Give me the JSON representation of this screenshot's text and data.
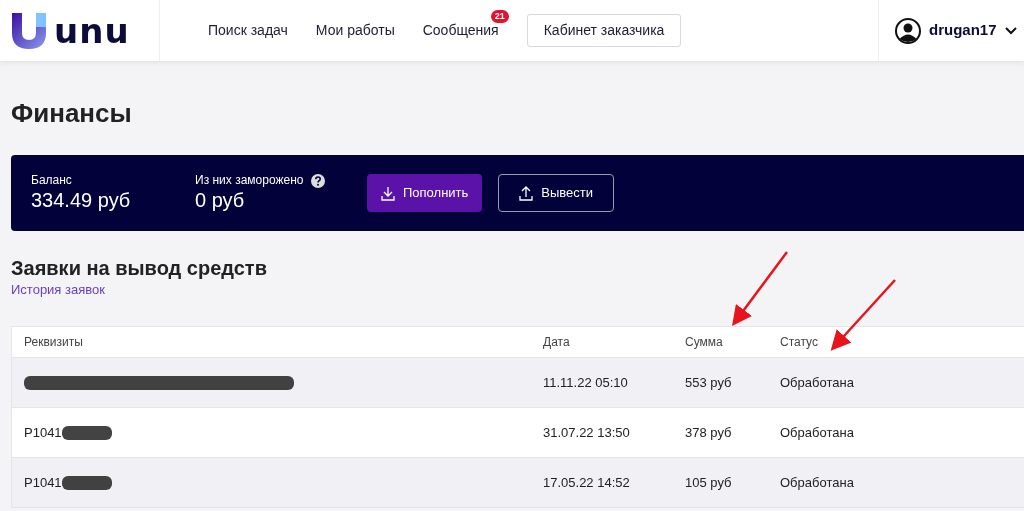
{
  "header": {
    "logo_text": "unu",
    "nav": [
      {
        "label": "Поиск задач"
      },
      {
        "label": "Мои работы"
      },
      {
        "label": "Сообщения",
        "badge": "21"
      }
    ],
    "customer_button": "Кабинет заказчика",
    "username": "drugan17"
  },
  "page_title": "Финансы",
  "balance_panel": {
    "balance_label": "Баланс",
    "balance_value": "334.49 руб",
    "frozen_label": "Из них заморожено",
    "frozen_value": "0 руб",
    "deposit_button": "Пополнить",
    "withdraw_button": "Вывести"
  },
  "withdrawals": {
    "title": "Заявки на вывод средств",
    "history_link": "История заявок",
    "table": {
      "columns": [
        "Реквизиты",
        "Дата",
        "Сумма",
        "Статус"
      ],
      "rows": [
        {
          "requisites": "",
          "redacted": true,
          "date": "11.11.22 05:10",
          "amount": "553 руб",
          "status": "Обработана"
        },
        {
          "requisites": "P1041",
          "redacted": true,
          "date": "31.07.22 13:50",
          "amount": "378 руб",
          "status": "Обработана"
        },
        {
          "requisites": "P1041",
          "redacted": true,
          "date": "17.05.22 14:52",
          "amount": "105 руб",
          "status": "Обработана"
        }
      ]
    }
  }
}
